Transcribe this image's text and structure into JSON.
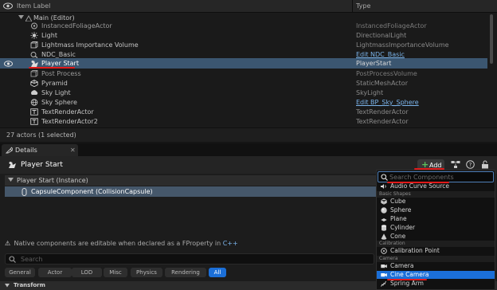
{
  "outliner": {
    "header": {
      "item_label": "Item Label",
      "type": "Type"
    },
    "rows": [
      {
        "label": "Main (Editor)",
        "type": "",
        "kind": "main"
      },
      {
        "label": "InstancedFoliageActor",
        "type": "InstancedFoliageActor",
        "icon": "foliage-icon"
      },
      {
        "label": "Light",
        "type": "DirectionalLight",
        "icon": "directional-light-icon"
      },
      {
        "label": "Lightmass Importance Volume",
        "type": "LightmassImportanceVolume",
        "icon": "volume-icon"
      },
      {
        "label": "NDC_Basic",
        "type": "Edit NDC_Basic",
        "icon": "ndc-icon",
        "type_link": true
      },
      {
        "label": "Player Start",
        "type": "PlayerStart",
        "icon": "player-start-icon",
        "selected": true
      },
      {
        "label": "Post Process",
        "type": "PostProcessVolume",
        "icon": "volume-icon"
      },
      {
        "label": "Pyramid",
        "type": "StaticMeshActor",
        "icon": "static-mesh-icon"
      },
      {
        "label": "Sky Light",
        "type": "SkyLight",
        "icon": "sky-light-icon"
      },
      {
        "label": "Sky Sphere",
        "type": "Edit BP_Sky_Sphere",
        "icon": "sky-sphere-icon",
        "type_link": true
      },
      {
        "label": "TextRenderActor",
        "type": "TextRenderActor",
        "icon": "text-render-icon"
      },
      {
        "label": "TextRenderActor2",
        "type": "TextRenderActor",
        "icon": "text-render-icon"
      }
    ],
    "footer": "27 actors (1 selected)"
  },
  "details": {
    "tab_label": "Details",
    "actor_name": "Player Start",
    "add_label": "Add",
    "instance_label": "Player Start (Instance)",
    "component_label": "CapsuleComponent (CollisionCapsule)",
    "native_note": "Native components are editable when declared as a FProperty in",
    "native_note_link": "C++",
    "search_placeholder": "Search",
    "filter_tabs": [
      "General",
      "Actor",
      "LOD",
      "Misc",
      "Physics",
      "Rendering",
      "All"
    ],
    "active_filter": "All",
    "section": "Transform"
  },
  "add_menu": {
    "search_placeholder": "Search Components",
    "items": [
      {
        "kind": "item",
        "label": "Audio Curve Source",
        "icon": "audio-curve-icon"
      },
      {
        "kind": "category",
        "label": "Basic Shapes"
      },
      {
        "kind": "item",
        "label": "Cube",
        "icon": "cube-icon"
      },
      {
        "kind": "item",
        "label": "Sphere",
        "icon": "sphere-icon"
      },
      {
        "kind": "item",
        "label": "Plane",
        "icon": "plane-icon"
      },
      {
        "kind": "item",
        "label": "Cylinder",
        "icon": "cylinder-icon"
      },
      {
        "kind": "item",
        "label": "Cone",
        "icon": "cone-icon"
      },
      {
        "kind": "category",
        "label": "Calibration"
      },
      {
        "kind": "item",
        "label": "Calibration Point",
        "icon": "calibration-point-icon"
      },
      {
        "kind": "category",
        "label": "Camera"
      },
      {
        "kind": "item",
        "label": "Camera",
        "icon": "camera-icon"
      },
      {
        "kind": "item",
        "label": "Cine Camera",
        "icon": "cine-camera-icon",
        "selected": true
      },
      {
        "kind": "item",
        "label": "Spring Arm",
        "icon": "spring-arm-icon"
      }
    ]
  },
  "colors": {
    "selection": "#3b5670",
    "accent_blue": "#1b6fd8",
    "link": "#7ab3ea",
    "add_green": "#5cc15c",
    "annotation_red": "#e01a1a"
  }
}
